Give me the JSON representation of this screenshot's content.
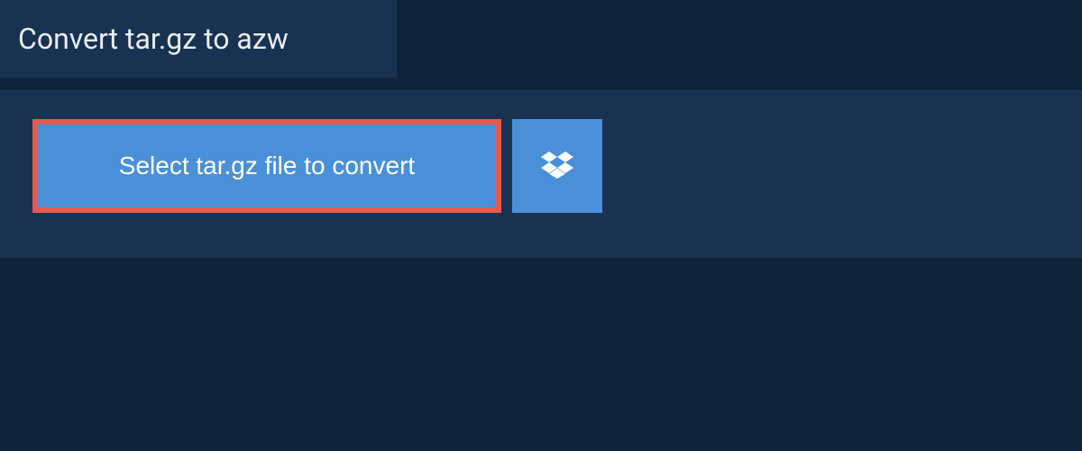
{
  "header": {
    "title": "Convert tar.gz to azw"
  },
  "actions": {
    "select_file_label": "Select tar.gz file to convert"
  },
  "colors": {
    "page_bg": "#0f2438",
    "panel_bg": "#1a3252",
    "button_bg": "#4a90d9",
    "button_border": "#e55a4f",
    "text_light": "#e8eef4",
    "text_white": "#ffffff"
  }
}
